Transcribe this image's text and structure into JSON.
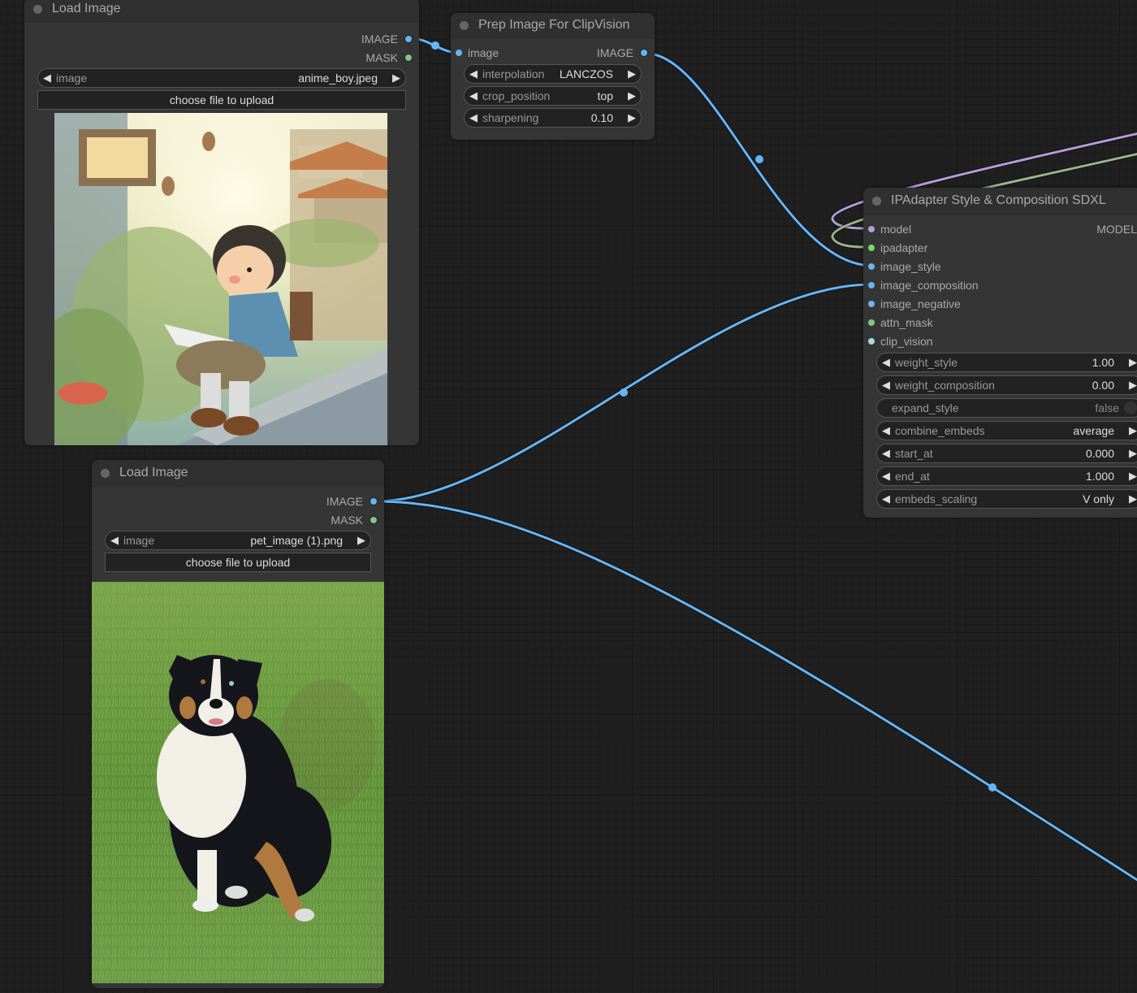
{
  "colors": {
    "image": "#64b5f6",
    "mask": "#81c784",
    "model": "#b39ddb",
    "ipadapter": "#6dde6d",
    "clip_vision": "#a8dadc",
    "wire_green": "#9bb58a"
  },
  "nodes": {
    "load_image_1": {
      "title": "Load Image",
      "outputs": [
        "IMAGE",
        "MASK"
      ],
      "image_widget": {
        "label": "image",
        "value": "anime_boy.jpeg"
      },
      "upload_label": "choose file to upload",
      "preview_alt": "watercolor anime boy reading a book on a stone wall"
    },
    "prep_image": {
      "title": "Prep Image For ClipVision",
      "input": "image",
      "output": "IMAGE",
      "widgets": [
        {
          "label": "interpolation",
          "value": "LANCZOS"
        },
        {
          "label": "crop_position",
          "value": "top"
        },
        {
          "label": "sharpening",
          "value": "0.10"
        }
      ]
    },
    "ipadapter": {
      "title": "IPAdapter Style & Composition SDXL",
      "output": "MODEL",
      "inputs": [
        {
          "label": "model",
          "color": "#b39ddb"
        },
        {
          "label": "ipadapter",
          "color": "#6dde6d"
        },
        {
          "label": "image_style",
          "color": "#64b5f6"
        },
        {
          "label": "image_composition",
          "color": "#64b5f6"
        },
        {
          "label": "image_negative",
          "color": "#64b5f6"
        },
        {
          "label": "attn_mask",
          "color": "#81c784"
        },
        {
          "label": "clip_vision",
          "color": "#a8dadc"
        }
      ],
      "widgets": [
        {
          "label": "weight_style",
          "value": "1.00",
          "type": "number"
        },
        {
          "label": "weight_composition",
          "value": "0.00",
          "type": "number"
        },
        {
          "label": "expand_style",
          "value": "false",
          "type": "toggle"
        },
        {
          "label": "combine_embeds",
          "value": "average",
          "type": "combo"
        },
        {
          "label": "start_at",
          "value": "0.000",
          "type": "number"
        },
        {
          "label": "end_at",
          "value": "1.000",
          "type": "number"
        },
        {
          "label": "embeds_scaling",
          "value": "V only",
          "type": "combo"
        }
      ]
    },
    "load_image_2": {
      "title": "Load Image",
      "outputs": [
        "IMAGE",
        "MASK"
      ],
      "image_widget": {
        "label": "image",
        "value": "pet_image (1).png"
      },
      "upload_label": "choose file to upload",
      "preview_alt": "tricolor Australian shepherd dog sitting on grass"
    }
  },
  "icons": {
    "left_arrow": "◀",
    "right_arrow": "▶"
  }
}
